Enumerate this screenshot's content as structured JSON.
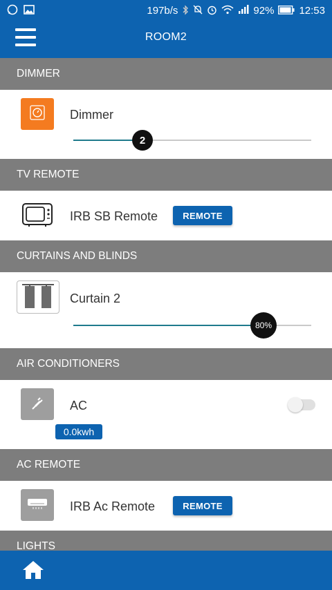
{
  "status_bar": {
    "net_speed": "197b/s",
    "battery_percent": "92%",
    "time": "12:53",
    "icons": [
      "whatsapp-icon",
      "gallery-icon",
      "bluetooth-icon",
      "mute-icon",
      "alarm-icon",
      "wifi-icon",
      "signal-icon",
      "battery-icon"
    ]
  },
  "appbar": {
    "title": "ROOM2"
  },
  "sections": {
    "dimmer": {
      "header": "DIMMER",
      "item_label": "Dimmer",
      "slider_value": "2",
      "slider_fraction": 0.29,
      "tile_color": "#f47b20"
    },
    "tv_remote": {
      "header": "TV REMOTE",
      "item_label": "IRB SB Remote",
      "button_label": "REMOTE"
    },
    "curtains": {
      "header": "CURTAINS AND BLINDS",
      "item_label": "Curtain 2",
      "slider_value": "80%",
      "slider_fraction": 0.8
    },
    "air_conditioners": {
      "header": "AIR CONDITIONERS",
      "item_label": "AC",
      "energy": "0.0kwh",
      "toggle_on": false,
      "tile_color": "#9e9e9e"
    },
    "ac_remote": {
      "header": "AC REMOTE",
      "item_label": "IRB Ac Remote",
      "button_label": "REMOTE"
    },
    "lights": {
      "header": "LIGHTS"
    }
  },
  "bottom_bar": {
    "icon": "home-icon"
  },
  "colors": {
    "primary": "#0d63b0",
    "section_header": "#7d7d7d",
    "slider_fill": "#1e7a8c"
  }
}
